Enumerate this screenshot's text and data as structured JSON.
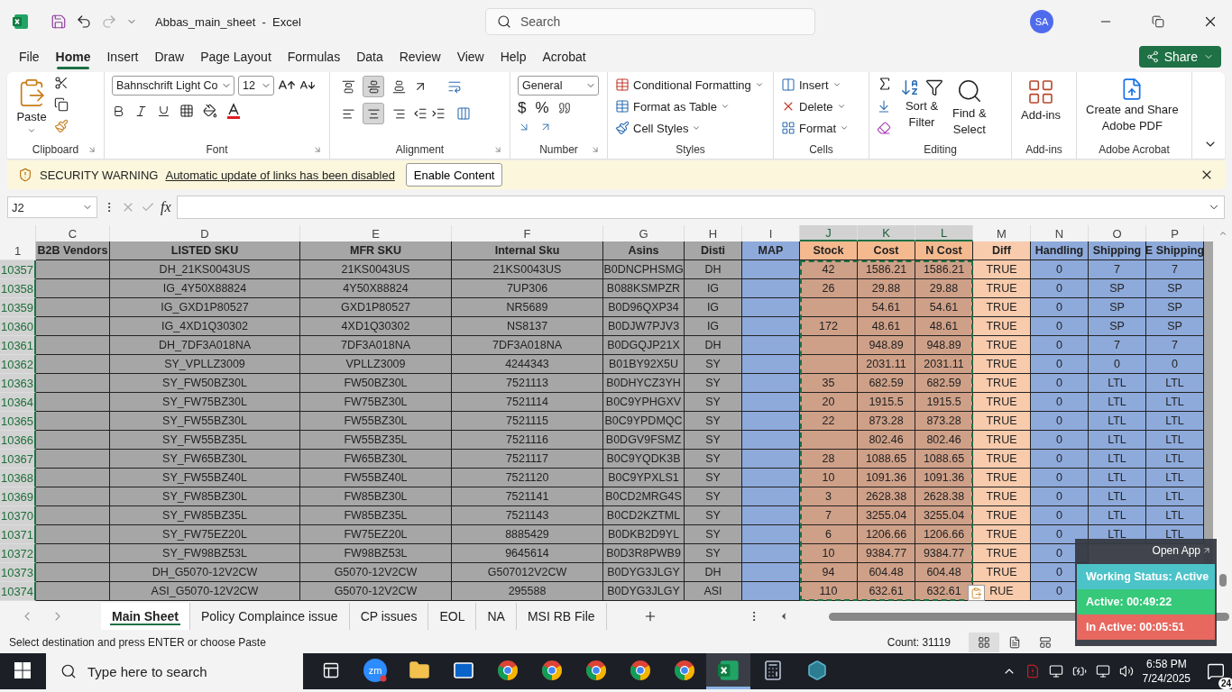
{
  "title_bar": {
    "redo_disabled": true,
    "file_title": "Abbas_main_sheet  -  Excel",
    "search_placeholder": "Search",
    "avatar": "SA"
  },
  "menu_tabs": [
    {
      "label": "File",
      "selected": false
    },
    {
      "label": "Home",
      "selected": true
    },
    {
      "label": "Insert",
      "selected": false
    },
    {
      "label": "Draw",
      "selected": false
    },
    {
      "label": "Page Layout",
      "selected": false
    },
    {
      "label": "Formulas",
      "selected": false
    },
    {
      "label": "Data",
      "selected": false
    },
    {
      "label": "Review",
      "selected": false
    },
    {
      "label": "View",
      "selected": false
    },
    {
      "label": "Help",
      "selected": false
    },
    {
      "label": "Acrobat",
      "selected": false
    }
  ],
  "share_button": "Share",
  "ribbon": {
    "clipboard": {
      "label": "Clipboard",
      "paste": "Paste"
    },
    "font": {
      "label": "Font",
      "font_name": "Bahnschrift Light Co",
      "font_size": "12"
    },
    "alignment": {
      "label": "Alignment",
      "vertical_selected": [
        false,
        true,
        false
      ],
      "horizontal_selected": [
        false,
        true,
        false
      ]
    },
    "number": {
      "label": "Number",
      "format": "General",
      "currency": "$",
      "percent": "%"
    },
    "styles": {
      "label": "Styles",
      "items": [
        "Conditional Formatting",
        "Format as Table",
        "Cell Styles"
      ]
    },
    "cells": {
      "label": "Cells",
      "items": [
        "Insert",
        "Delete",
        "Format"
      ]
    },
    "editing": {
      "label": "Editing",
      "sort": [
        "Sort &",
        "Filter"
      ],
      "find": [
        "Find &",
        "Select"
      ]
    },
    "add_ins": {
      "label": "Add-ins",
      "button": "Add-ins"
    },
    "acrobat": {
      "label": "Adobe Acrobat",
      "button": [
        "Create and Share",
        "Adobe PDF"
      ]
    }
  },
  "security_bar": {
    "title": "SECURITY WARNING",
    "message": "Automatic update of links has been disabled",
    "button": "Enable Content"
  },
  "formula_bar": {
    "name_box": "J2",
    "fx": "fx"
  },
  "sheet": {
    "columns": [
      {
        "letter": "C",
        "color": "#a6a6a6",
        "selected": false
      },
      {
        "letter": "D",
        "color": "#a6a6a6",
        "selected": false
      },
      {
        "letter": "E",
        "color": "#a6a6a6",
        "selected": false
      },
      {
        "letter": "F",
        "color": "#a6a6a6",
        "selected": false
      },
      {
        "letter": "G",
        "color": "#a6a6a6",
        "selected": false
      },
      {
        "letter": "H",
        "color": "#a6a6a6",
        "selected": false
      },
      {
        "letter": "I",
        "color": "#8eaadb",
        "selected": false
      },
      {
        "letter": "J",
        "color": "#cfa088",
        "selected": true
      },
      {
        "letter": "K",
        "color": "#cfa088",
        "selected": true
      },
      {
        "letter": "L",
        "color": "#cfa088",
        "selected": true
      },
      {
        "letter": "M",
        "color": "#f8cbad",
        "selected": false
      },
      {
        "letter": "N",
        "color": "#8eaadb",
        "selected": false
      },
      {
        "letter": "O",
        "color": "#8eaadb",
        "selected": false
      },
      {
        "letter": "P",
        "color": "#8eaadb",
        "selected": false
      }
    ],
    "header_row": {
      "number": "1",
      "cells": [
        {
          "text": "B2B Vendors",
          "color": "#a6a6a6"
        },
        {
          "text": "LISTED SKU",
          "color": "#a6a6a6"
        },
        {
          "text": "MFR SKU",
          "color": "#a6a6a6"
        },
        {
          "text": "Internal Sku",
          "color": "#a6a6a6"
        },
        {
          "text": "Asins",
          "color": "#a6a6a6"
        },
        {
          "text": "Disti",
          "color": "#a6a6a6"
        },
        {
          "text": "MAP",
          "color": "#8eaadb"
        },
        {
          "text": "Stock",
          "color": "#f4b98f"
        },
        {
          "text": "Cost",
          "color": "#f4b98f"
        },
        {
          "text": "N Cost",
          "color": "#f4b98f"
        },
        {
          "text": "Diff",
          "color": "#f8cbad"
        },
        {
          "text": "Handling",
          "color": "#8eaadb"
        },
        {
          "text": "Shipping",
          "color": "#8eaadb"
        },
        {
          "text": "E Shipping",
          "color": "#8eaadb"
        }
      ]
    },
    "rows": [
      {
        "number": "10357",
        "cells": [
          null,
          "DH_21KS0043US",
          "21KS0043US",
          "21KS0043US",
          "B0DNCPHSMG",
          "DH",
          null,
          "42",
          "1586.21",
          "1586.21",
          "TRUE",
          "0",
          "7",
          "7"
        ]
      },
      {
        "number": "10358",
        "cells": [
          null,
          "IG_4Y50X88824",
          "4Y50X88824",
          "7UP306",
          "B088KSMPZR",
          "IG",
          null,
          "26",
          "29.88",
          "29.88",
          "TRUE",
          "0",
          "SP",
          "SP"
        ]
      },
      {
        "number": "10359",
        "cells": [
          null,
          "IG_GXD1P80527",
          "GXD1P80527",
          "NR5689",
          "B0D96QXP34",
          "IG",
          null,
          null,
          "54.61",
          "54.61",
          "TRUE",
          "0",
          "SP",
          "SP"
        ]
      },
      {
        "number": "10360",
        "cells": [
          null,
          "IG_4XD1Q30302",
          "4XD1Q30302",
          "NS8137",
          "B0DJW7PJV3",
          "IG",
          null,
          "172",
          "48.61",
          "48.61",
          "TRUE",
          "0",
          "SP",
          "SP"
        ]
      },
      {
        "number": "10361",
        "cells": [
          null,
          "DH_7DF3A018NA",
          "7DF3A018NA",
          "7DF3A018NA",
          "B0DGQJP21X",
          "DH",
          null,
          null,
          "948.89",
          "948.89",
          "TRUE",
          "0",
          "7",
          "7"
        ]
      },
      {
        "number": "10362",
        "cells": [
          null,
          "SY_VPLLZ3009",
          "VPLLZ3009",
          "4244343",
          "B01BY92X5U",
          "SY",
          null,
          null,
          "2031.11",
          "2031.11",
          "TRUE",
          "0",
          "0",
          "0"
        ]
      },
      {
        "number": "10363",
        "cells": [
          null,
          "SY_FW50BZ30L",
          "FW50BZ30L",
          "7521113",
          "B0DHYCZ3YH",
          "SY",
          null,
          "35",
          "682.59",
          "682.59",
          "TRUE",
          "0",
          "LTL",
          "LTL"
        ]
      },
      {
        "number": "10364",
        "cells": [
          null,
          "SY_FW75BZ30L",
          "FW75BZ30L",
          "7521114",
          "B0C9YPHGXV",
          "SY",
          null,
          "20",
          "1915.5",
          "1915.5",
          "TRUE",
          "0",
          "LTL",
          "LTL"
        ]
      },
      {
        "number": "10365",
        "cells": [
          null,
          "SY_FW55BZ30L",
          "FW55BZ30L",
          "7521115",
          "B0C9YPDMQC",
          "SY",
          null,
          "22",
          "873.28",
          "873.28",
          "TRUE",
          "0",
          "LTL",
          "LTL"
        ]
      },
      {
        "number": "10366",
        "cells": [
          null,
          "SY_FW55BZ35L",
          "FW55BZ35L",
          "7521116",
          "B0DGV9FSMZ",
          "SY",
          null,
          null,
          "802.46",
          "802.46",
          "TRUE",
          "0",
          "LTL",
          "LTL"
        ]
      },
      {
        "number": "10367",
        "cells": [
          null,
          "SY_FW65BZ30L",
          "FW65BZ30L",
          "7521117",
          "B0C9YQDK3B",
          "SY",
          null,
          "28",
          "1088.65",
          "1088.65",
          "TRUE",
          "0",
          "LTL",
          "LTL"
        ]
      },
      {
        "number": "10368",
        "cells": [
          null,
          "SY_FW55BZ40L",
          "FW55BZ40L",
          "7521120",
          "B0C9YPXLS1",
          "SY",
          null,
          "10",
          "1091.36",
          "1091.36",
          "TRUE",
          "0",
          "LTL",
          "LTL"
        ]
      },
      {
        "number": "10369",
        "cells": [
          null,
          "SY_FW85BZ30L",
          "FW85BZ30L",
          "7521141",
          "B0CD2MRG4S",
          "SY",
          null,
          "3",
          "2628.38",
          "2628.38",
          "TRUE",
          "0",
          "LTL",
          "LTL"
        ]
      },
      {
        "number": "10370",
        "cells": [
          null,
          "SY_FW85BZ35L",
          "FW85BZ35L",
          "7521143",
          "B0CD2KZTML",
          "SY",
          null,
          "7",
          "3255.04",
          "3255.04",
          "TRUE",
          "0",
          "LTL",
          "LTL"
        ]
      },
      {
        "number": "10371",
        "cells": [
          null,
          "SY_FW75EZ20L",
          "FW75EZ20L",
          "8885429",
          "B0DKB2D9YL",
          "SY",
          null,
          "6",
          "1206.66",
          "1206.66",
          "TRUE",
          "0",
          "LTL",
          "LTL"
        ]
      },
      {
        "number": "10372",
        "cells": [
          null,
          "SY_FW98BZ53L",
          "FW98BZ53L",
          "9645614",
          "B0D3R8PWB9",
          "SY",
          null,
          "10",
          "9384.77",
          "9384.77",
          "TRUE",
          "0"
        ]
      },
      {
        "number": "10373",
        "cells": [
          null,
          "DH_G5070-12V2CW",
          "G5070-12V2CW",
          "G507012V2CW",
          "B0DYG3JLGY",
          "DH",
          null,
          "94",
          "604.48",
          "604.48",
          "TRUE",
          "0"
        ]
      },
      {
        "number": "10374",
        "cells": [
          null,
          "ASI_G5070-12V2CW",
          "G5070-12V2CW",
          "295588",
          "B0DYG3JLGY",
          "ASI",
          null,
          "110",
          "632.61",
          "632.61",
          "RUE",
          "0"
        ]
      }
    ]
  },
  "sheet_tabs": [
    {
      "label": "Main Sheet",
      "selected": true
    },
    {
      "label": "Policy Complaince issue",
      "selected": false
    },
    {
      "label": "CP issues",
      "selected": false
    },
    {
      "label": "EOL",
      "selected": false
    },
    {
      "label": "NA",
      "selected": false
    },
    {
      "label": "MSI RB File",
      "selected": false
    }
  ],
  "status_bar": {
    "message": "Select destination and press ENTER or choose Paste",
    "count": "Count: 31119"
  },
  "time_tracker": {
    "open_app": "Open App",
    "statuses": [
      {
        "label": "Working Status: Active",
        "color": "#4cc3c9"
      },
      {
        "label": "Active: 00:49:22",
        "color": "#36c97a"
      },
      {
        "label": "In Active: 00:05:51",
        "color": "#e8675e"
      }
    ]
  },
  "taskbar": {
    "search_placeholder": "Type here to search",
    "zoom_label": "zm",
    "time": "6:58 PM",
    "date": "7/24/2025",
    "notifications": "24",
    "apps": [
      {
        "kind": "task-view",
        "selected": false
      },
      {
        "kind": "zoom",
        "selected": false
      },
      {
        "kind": "folder",
        "selected": false
      },
      {
        "kind": "mail",
        "selected": false
      },
      {
        "kind": "browser",
        "selected": false
      },
      {
        "kind": "browser",
        "selected": false
      },
      {
        "kind": "browser",
        "selected": false
      },
      {
        "kind": "browser",
        "selected": false
      },
      {
        "kind": "browser",
        "selected": false
      },
      {
        "kind": "excel",
        "selected": true
      },
      {
        "kind": "calculator",
        "selected": false
      },
      {
        "kind": "hexagon",
        "selected": false
      }
    ]
  }
}
